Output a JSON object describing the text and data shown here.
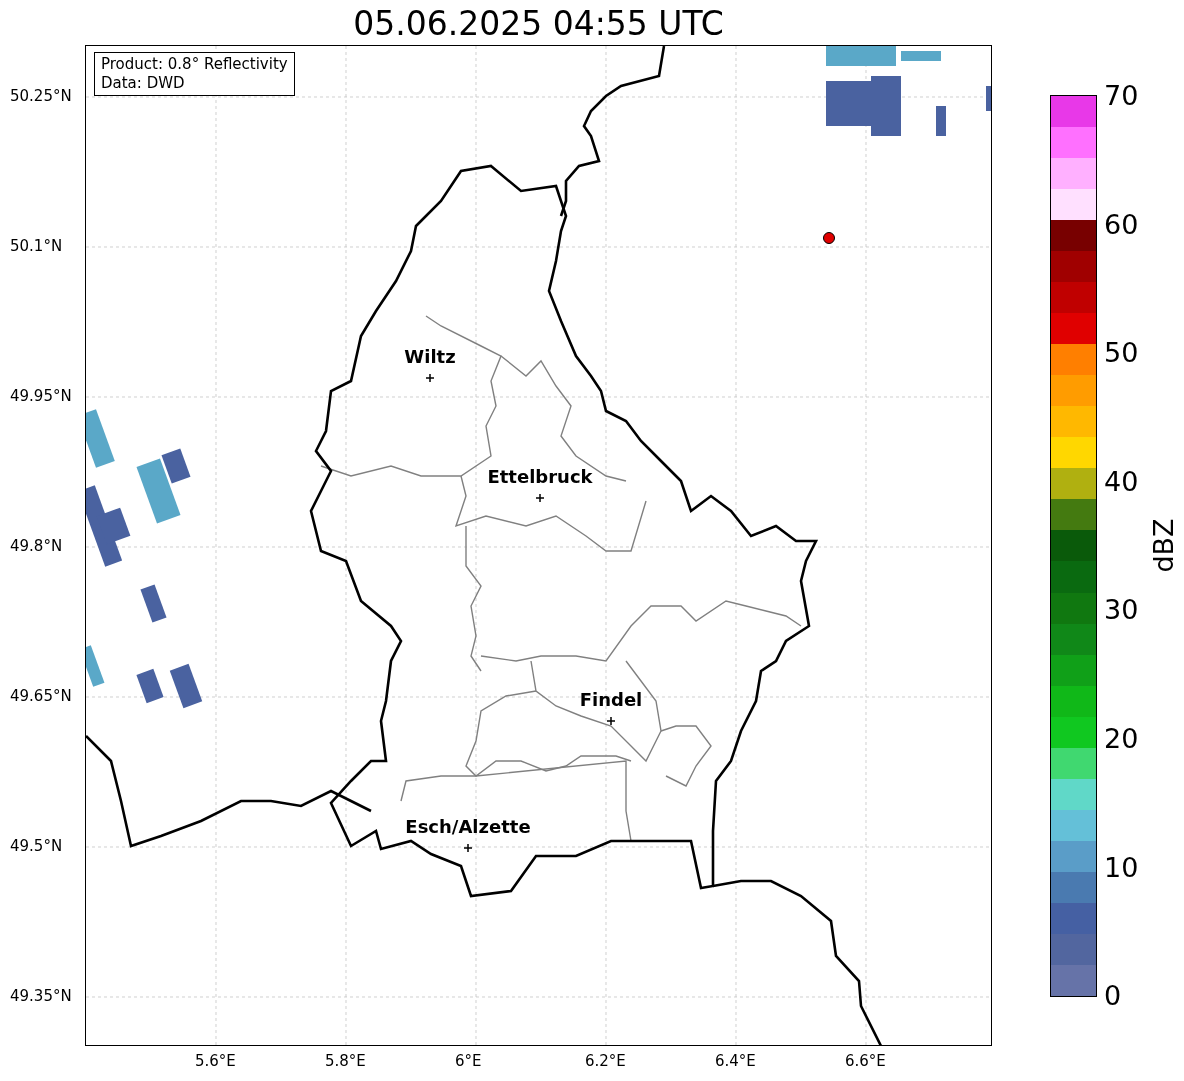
{
  "title": "05.06.2025 04:55 UTC",
  "info_box": [
    "Product: 0.8° Reflectivity",
    "Data: DWD"
  ],
  "y_ticks": [
    "50.25°N",
    "50.1°N",
    "49.95°N",
    "49.8°N",
    "49.65°N",
    "49.5°N",
    "49.35°N"
  ],
  "x_ticks": [
    "5.6°E",
    "5.8°E",
    "6°E",
    "6.2°E",
    "6.4°E",
    "6.6°E"
  ],
  "cities": [
    {
      "name": "Wiltz"
    },
    {
      "name": "Ettelbruck"
    },
    {
      "name": "Findel"
    },
    {
      "name": "Esch/Alzette"
    }
  ],
  "colorbar": {
    "label": "dBZ",
    "ticks": [
      "70",
      "60",
      "50",
      "40",
      "30",
      "20",
      "10",
      "0"
    ],
    "segments": [
      {
        "color": "#e838e8"
      },
      {
        "color": "#ff70ff"
      },
      {
        "color": "#ffb0ff"
      },
      {
        "color": "#ffe0ff"
      },
      {
        "color": "#780000"
      },
      {
        "color": "#a00000"
      },
      {
        "color": "#c00000"
      },
      {
        "color": "#e00000"
      },
      {
        "color": "#ff7f00"
      },
      {
        "color": "#ff9c00"
      },
      {
        "color": "#ffb800"
      },
      {
        "color": "#ffd700"
      },
      {
        "color": "#b0b010"
      },
      {
        "color": "#447a10"
      },
      {
        "color": "#0a5a0a"
      },
      {
        "color": "#0a6a10"
      },
      {
        "color": "#107810"
      },
      {
        "color": "#108818"
      },
      {
        "color": "#10a018"
      },
      {
        "color": "#10b818"
      },
      {
        "color": "#10c820"
      },
      {
        "color": "#40d870"
      },
      {
        "color": "#60d8c8"
      },
      {
        "color": "#64c0d8"
      },
      {
        "color": "#5a9dc8"
      },
      {
        "color": "#4a7ab0"
      },
      {
        "color": "#4560a3"
      },
      {
        "color": "#52669f"
      },
      {
        "color": "#6673a8"
      }
    ]
  }
}
